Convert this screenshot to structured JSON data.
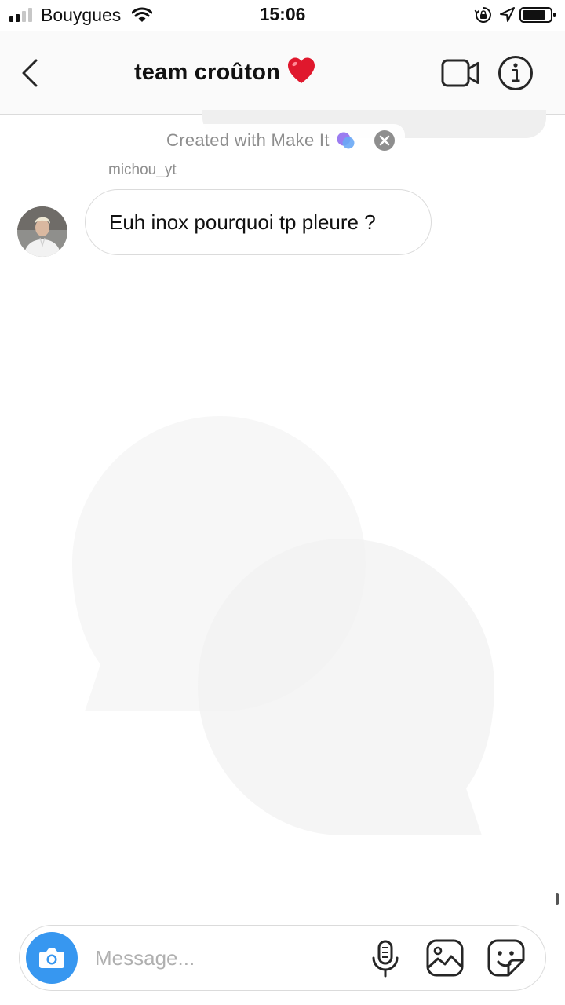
{
  "status_bar": {
    "carrier": "Bouygues",
    "time": "15:06",
    "icons": [
      "signal-icon",
      "wifi-icon",
      "rotation-lock-icon",
      "location-icon",
      "battery-icon"
    ]
  },
  "header": {
    "title": "team croûton",
    "icons": [
      "back-arrow-icon",
      "heart-icon",
      "video-call-icon",
      "info-icon"
    ]
  },
  "made_with_banner": {
    "text": "Created with Make It",
    "icons": [
      "bubbles-icon",
      "close-icon"
    ]
  },
  "messages": [
    {
      "sender": "michou_yt",
      "text": "Euh inox pourquoi tp pleure ?"
    }
  ],
  "composer": {
    "placeholder": "Message...",
    "icons": [
      "camera-icon",
      "microphone-icon",
      "gallery-icon",
      "sticker-icon"
    ]
  },
  "colors": {
    "accent": "#3797f0",
    "header_bg": "#fafafa",
    "border": "#dbdbdb",
    "secondary_text": "#8e8e8e",
    "heart": "#e0182d"
  }
}
